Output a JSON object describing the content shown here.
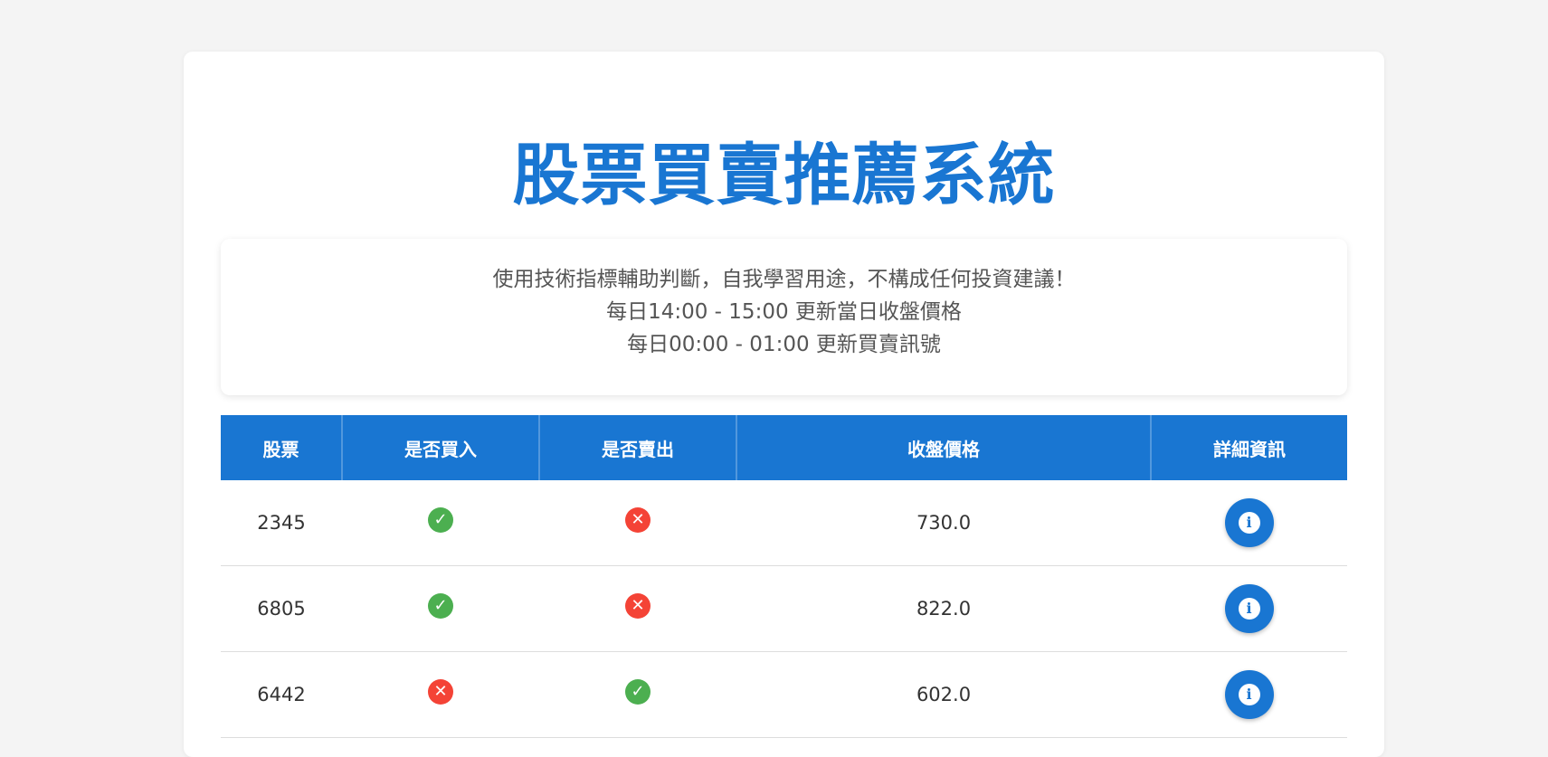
{
  "page": {
    "title": "股票買賣推薦系統"
  },
  "notice": {
    "lines": [
      "使用技術指標輔助判斷，自我學習用途，不構成任何投資建議！",
      "每日14:00 - 15:00 更新當日收盤價格",
      "每日00:00 - 01:00 更新買賣訊號"
    ]
  },
  "table": {
    "headers": [
      "股票",
      "是否買入",
      "是否賣出",
      "收盤價格",
      "詳細資訊"
    ],
    "rows": [
      {
        "stock": "2345",
        "buy": true,
        "sell": false,
        "close_price": "730.0"
      },
      {
        "stock": "6805",
        "buy": true,
        "sell": false,
        "close_price": "822.0"
      },
      {
        "stock": "6442",
        "buy": false,
        "sell": true,
        "close_price": "602.0"
      }
    ]
  },
  "icons": {
    "yes": "check-circle-icon",
    "no": "x-circle-icon",
    "info": "info-icon"
  },
  "colors": {
    "primary": "#1976d2",
    "yes": "#4caf50",
    "no": "#f44336",
    "background": "#f4f4f4"
  }
}
